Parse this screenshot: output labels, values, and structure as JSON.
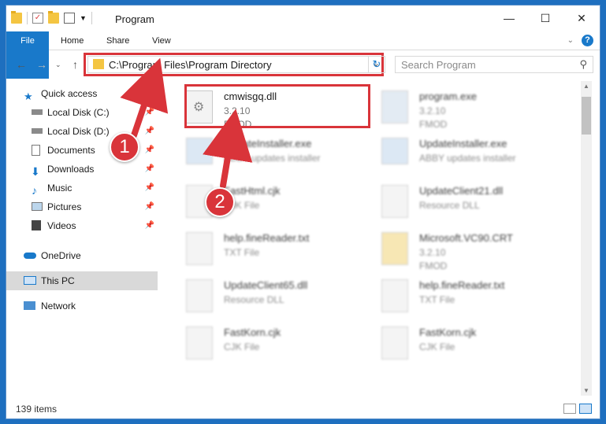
{
  "window": {
    "title": "Program"
  },
  "ribbon": {
    "tabs": [
      "File",
      "Home",
      "Share",
      "View"
    ]
  },
  "title_controls": {
    "minimize": "—",
    "maximize": "☐",
    "close": "✕"
  },
  "address": {
    "path": "C:\\Program Files\\Program Directory",
    "search_placeholder": "Search Program"
  },
  "sidebar": {
    "items": [
      {
        "label": "Quick access",
        "icon": "star-icon",
        "pinned": false
      },
      {
        "label": "Local Disk (C:)",
        "icon": "drive-icon",
        "pinned": true
      },
      {
        "label": "Local Disk (D:)",
        "icon": "drive-icon",
        "pinned": true
      },
      {
        "label": "Documents",
        "icon": "documents-icon",
        "pinned": true
      },
      {
        "label": "Downloads",
        "icon": "download-icon",
        "pinned": true
      },
      {
        "label": "Music",
        "icon": "music-icon",
        "pinned": true
      },
      {
        "label": "Pictures",
        "icon": "pictures-icon",
        "pinned": true
      },
      {
        "label": "Videos",
        "icon": "videos-icon",
        "pinned": true
      },
      {
        "label": "OneDrive",
        "icon": "cloud-icon",
        "pinned": false
      },
      {
        "label": "This PC",
        "icon": "pc-icon",
        "pinned": false
      },
      {
        "label": "Network",
        "icon": "network-icon",
        "pinned": false
      }
    ]
  },
  "files": [
    {
      "name": "cmwisgq.dll",
      "line2": "3.2.10",
      "line3": "FMOD",
      "icon": "dll-gear-icon"
    },
    {
      "name": "program.exe",
      "line2": "3.2.10",
      "line3": "FMOD",
      "icon": "exe-icon"
    },
    {
      "name": "UpdateInstaller.exe",
      "line2": "ABBY updates installer",
      "line3": "",
      "icon": "installer-icon"
    },
    {
      "name": "UpdateInstaller.exe",
      "line2": "ABBY updates installer",
      "line3": "",
      "icon": "installer-icon"
    },
    {
      "name": "FastHtml.cjk",
      "line2": "CJK File",
      "line3": "",
      "icon": "file-icon"
    },
    {
      "name": "UpdateClient21.dll",
      "line2": "Resource DLL",
      "line3": "",
      "icon": "dll-gear-icon"
    },
    {
      "name": "help.fineReader.txt",
      "line2": "TXT File",
      "line3": "",
      "icon": "text-file-icon"
    },
    {
      "name": "Microsoft.VC90.CRT",
      "line2": "3.2.10",
      "line3": "FMOD",
      "icon": "folder-doc-icon"
    },
    {
      "name": "UpdateClient65.dll",
      "line2": "Resource DLL",
      "line3": "",
      "icon": "dll-gear-icon"
    },
    {
      "name": "help.fineReader.txt",
      "line2": "TXT File",
      "line3": "",
      "icon": "text-file-icon"
    },
    {
      "name": "FastKorn.cjk",
      "line2": "CJK File",
      "line3": "",
      "icon": "file-icon"
    },
    {
      "name": "FastKorn.cjk",
      "line2": "CJK File",
      "line3": "",
      "icon": "file-icon"
    }
  ],
  "status": {
    "count": "139 items"
  },
  "annotations": {
    "step1": "1",
    "step2": "2",
    "color": "#d9343a"
  }
}
